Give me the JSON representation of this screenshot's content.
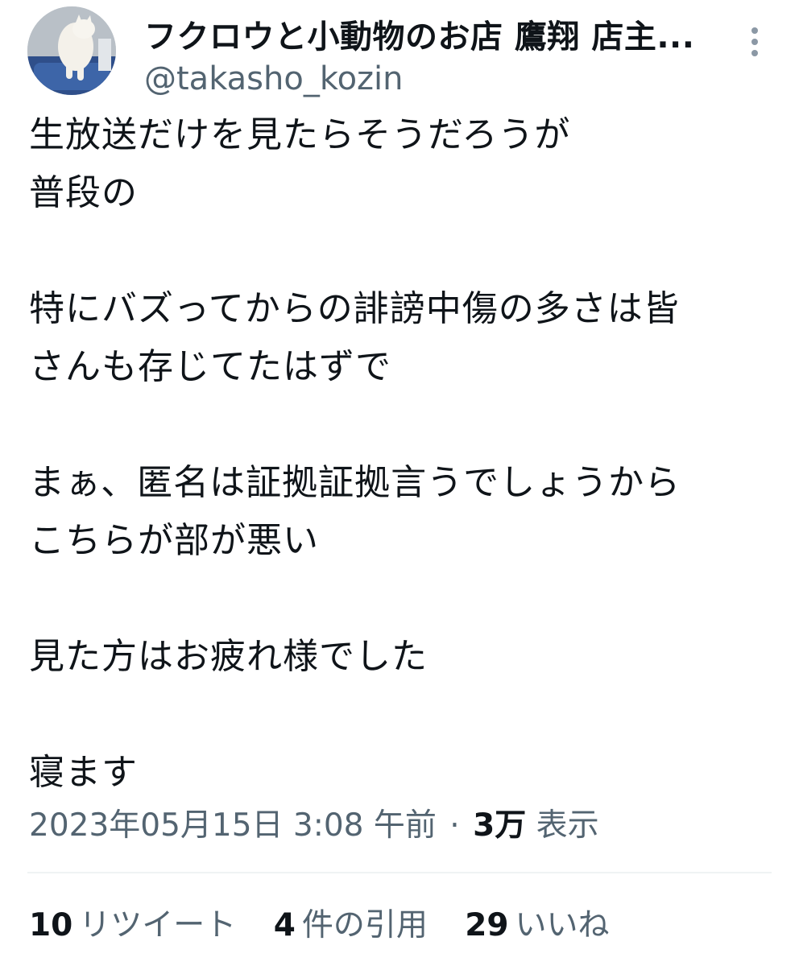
{
  "author": {
    "display_name": "フクロウと小動物のお店 鷹翔 店主...",
    "handle": "@takasho_kozin",
    "avatar_icon": "cat-avatar-icon"
  },
  "menu_icon": "more-vertical-icon",
  "tweet": {
    "lines": [
      "生放送だけを見たらそうだろうが",
      "普段の",
      "",
      "特にバズってからの誹謗中傷の多さは皆",
      "さんも存じてたはずで",
      "",
      "まぁ、匿名は証拠証拠言うでしょうから",
      "こちらが部が悪い",
      "",
      "見た方はお疲れ様でした",
      "",
      "寝ます"
    ]
  },
  "meta": {
    "timestamp": "2023年05月15日 3:08 午前",
    "separator": "·",
    "views_count": "3万",
    "views_label": "表示"
  },
  "stats": {
    "retweets_count": "10",
    "retweets_label": "リツイート",
    "quotes_count": "4",
    "quotes_label": "件の引用",
    "likes_count": "29",
    "likes_label": "いいね"
  },
  "colors": {
    "text_primary": "#0f1419",
    "text_secondary": "#536471",
    "divider": "#eff3f4"
  }
}
